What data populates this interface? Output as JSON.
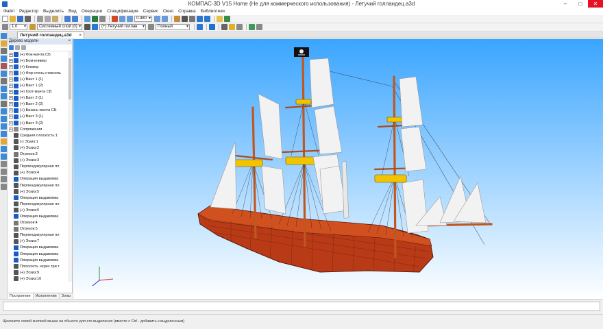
{
  "window": {
    "title": "КОМПАС-3D V15 Home (Не для коммерческого использования) - Летучий голландец.a3d",
    "min": "–",
    "max": "□",
    "close": "✕"
  },
  "menu": [
    "Файл",
    "Редактор",
    "Выделить",
    "Вид",
    "Операции",
    "Спецификация",
    "Сервис",
    "Окно",
    "Справка",
    "Библиотеки"
  ],
  "toolbar": {
    "scale": "1.0",
    "layer": "Системный слой (0)",
    "model_select": "(+) Летучий голлан",
    "zoom": "0.480",
    "display_mode": "Полный"
  },
  "document_tab": {
    "label": "Летучий голландец.a3d",
    "close": "×"
  },
  "panel": {
    "title": "Дерево модели",
    "close": "×",
    "tabs": [
      "Построение",
      "Исполнения",
      "Зоны"
    ]
  },
  "tree": [
    {
      "label": "(+) Фок-мачта СБ",
      "exp": "+",
      "icon": "#1a5cc6"
    },
    {
      "label": "(+) Бом-кливер",
      "exp": "+",
      "icon": "#1a5cc6"
    },
    {
      "label": "(+) Кливер",
      "exp": "+",
      "icon": "#1a5cc6"
    },
    {
      "label": "(+) Фор-стень-стаксель",
      "exp": "+",
      "icon": "#1a5cc6"
    },
    {
      "label": "(+) Вант 1 (1)",
      "exp": "+",
      "icon": "#1a5cc6"
    },
    {
      "label": "(+) Вант 1 (2)",
      "exp": "+",
      "icon": "#1a5cc6"
    },
    {
      "label": "(+) Грот-мачта СБ",
      "exp": "+",
      "icon": "#1a5cc6"
    },
    {
      "label": "(+) Вант 2 (1)",
      "exp": "+",
      "icon": "#1a5cc6"
    },
    {
      "label": "(+) Вант 2 (2)",
      "exp": "+",
      "icon": "#1a5cc6"
    },
    {
      "label": "(+) Бизань-мачта СБ",
      "exp": "+",
      "icon": "#1a5cc6"
    },
    {
      "label": "(+) Вант 3 (1)",
      "exp": "+",
      "icon": "#1a5cc6"
    },
    {
      "label": "(+) Вант 3 (2)",
      "exp": "+",
      "icon": "#1a5cc6"
    },
    {
      "label": "Сопряжения",
      "exp": "+",
      "icon": "#8a8a8a"
    },
    {
      "label": "Средняя плоскость:1",
      "exp": "",
      "icon": "#555555"
    },
    {
      "label": "(-) Эскиз:1",
      "exp": "",
      "icon": "#555555"
    },
    {
      "label": "(+) Эскиз:2",
      "exp": "",
      "icon": "#555555"
    },
    {
      "label": "Отрезок:3",
      "exp": "",
      "icon": "#777777"
    },
    {
      "label": "(+) Эскиз:3",
      "exp": "",
      "icon": "#555555"
    },
    {
      "label": "Перпендикулярная пл",
      "exp": "",
      "icon": "#555555"
    },
    {
      "label": "(+) Эскиз:4",
      "exp": "",
      "icon": "#555555"
    },
    {
      "label": "Операция выдавлива",
      "exp": "",
      "icon": "#1a5cc6"
    },
    {
      "label": "Перпендикулярная пл",
      "exp": "",
      "icon": "#555555"
    },
    {
      "label": "(+) Эскиз:5",
      "exp": "",
      "icon": "#555555"
    },
    {
      "label": "Операция выдавлива",
      "exp": "",
      "icon": "#1a5cc6"
    },
    {
      "label": "Перпендикулярная пл",
      "exp": "",
      "icon": "#555555"
    },
    {
      "label": "(+) Эскиз:6",
      "exp": "",
      "icon": "#555555"
    },
    {
      "label": "Операция выдавлива",
      "exp": "",
      "icon": "#1a5cc6"
    },
    {
      "label": "Отрезок:4",
      "exp": "",
      "icon": "#777777"
    },
    {
      "label": "Отрезок:5",
      "exp": "",
      "icon": "#777777"
    },
    {
      "label": "Перпендикулярная пл",
      "exp": "",
      "icon": "#555555"
    },
    {
      "label": "(+) Эскиз:7",
      "exp": "",
      "icon": "#555555"
    },
    {
      "label": "Операция выдавлива",
      "exp": "",
      "icon": "#1a5cc6"
    },
    {
      "label": "Операция выдавлива",
      "exp": "",
      "icon": "#1a5cc6"
    },
    {
      "label": "Операция выдавлива",
      "exp": "",
      "icon": "#1a5cc6"
    },
    {
      "label": "Плоскость через три т",
      "exp": "",
      "icon": "#555555"
    },
    {
      "label": "(+) Эскиз:9",
      "exp": "",
      "icon": "#555555"
    },
    {
      "label": "(+) Эскиз:10",
      "exp": "",
      "icon": "#555555"
    }
  ],
  "status": {
    "hint": "Щелкните левой кнопкой мыши на объекте для его выделения (вместе с Ctrl - добавить к выделенным)"
  },
  "colors": {
    "hull": "#b83a16",
    "sail": "#f2f2f2",
    "mast": "#c0571f",
    "top_platform": "#f2c400"
  }
}
